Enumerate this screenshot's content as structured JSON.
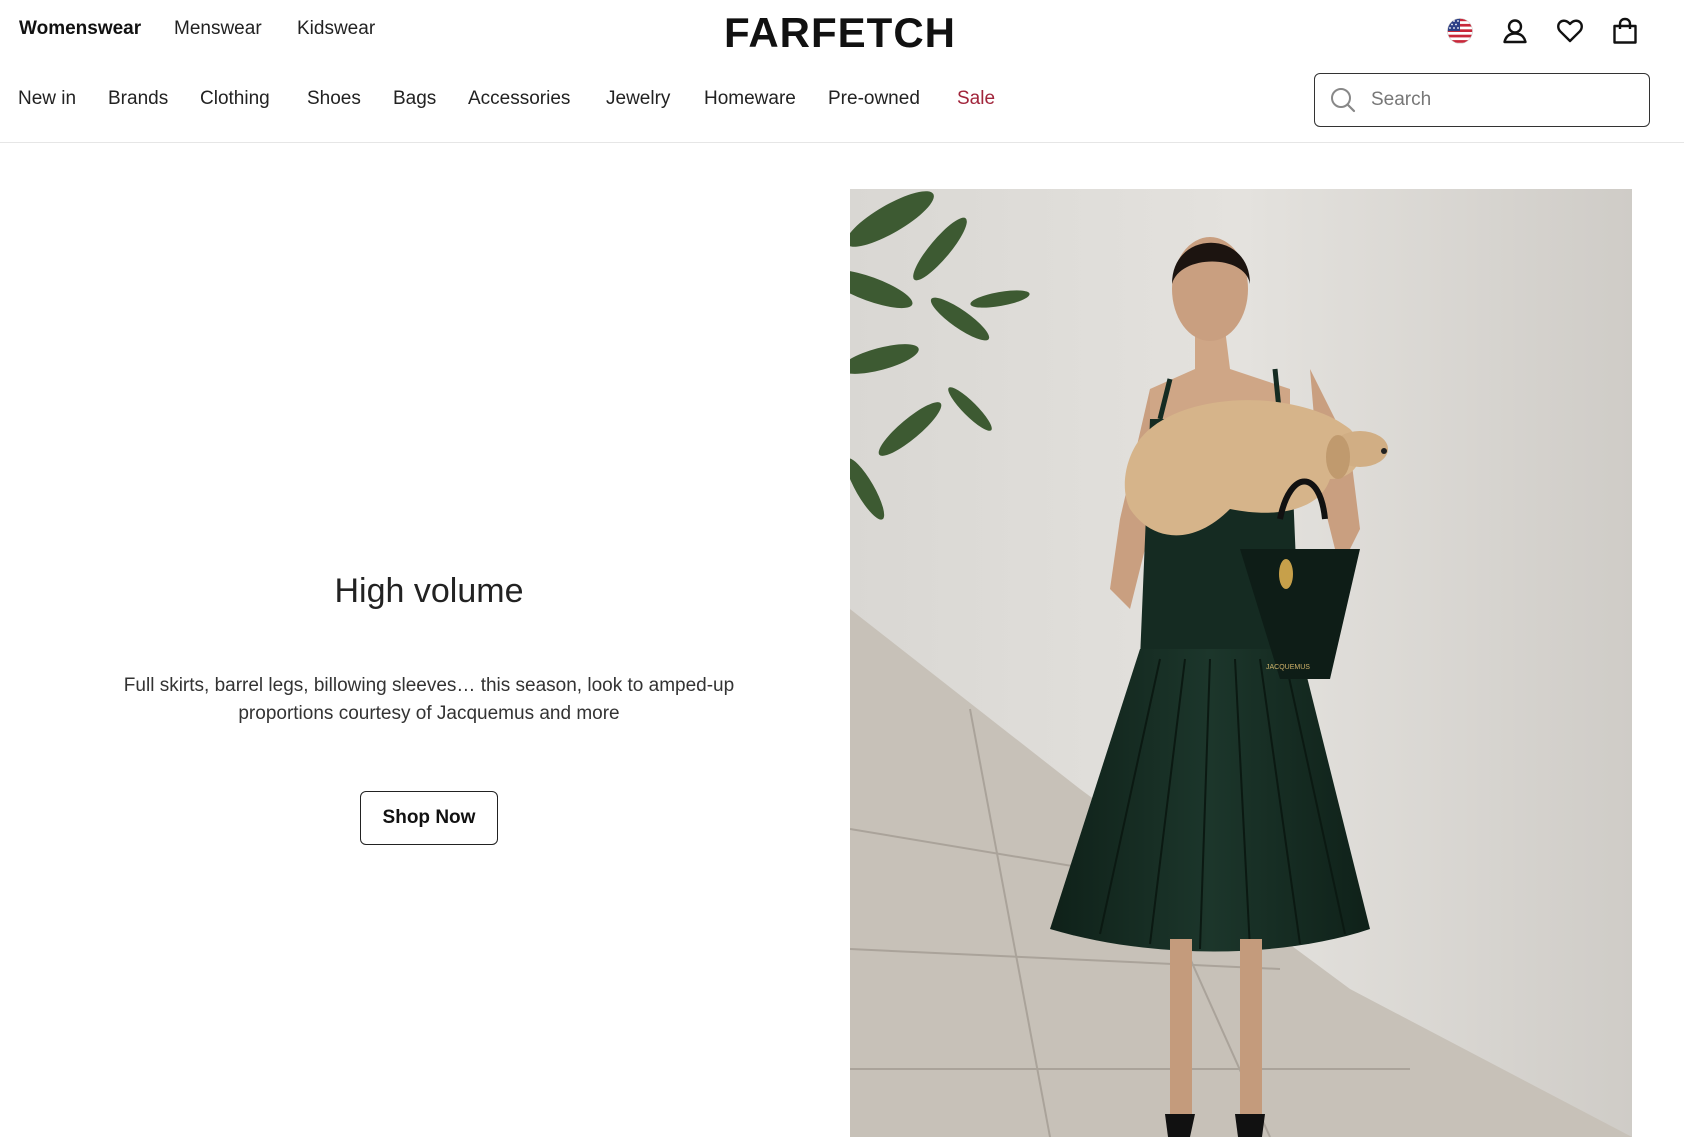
{
  "header": {
    "gender_tabs": [
      {
        "label": "Womenswear",
        "active": true
      },
      {
        "label": "Menswear",
        "active": false
      },
      {
        "label": "Kidswear",
        "active": false
      }
    ],
    "logo_text": "FARFETCH",
    "utility_icons": [
      "us-flag-icon",
      "account-icon",
      "wishlist-heart-icon",
      "shopping-bag-icon"
    ]
  },
  "nav": {
    "items": [
      {
        "label": "New in"
      },
      {
        "label": "Brands"
      },
      {
        "label": "Clothing"
      },
      {
        "label": "Shoes"
      },
      {
        "label": "Bags"
      },
      {
        "label": "Accessories"
      },
      {
        "label": "Jewelry"
      },
      {
        "label": "Homeware"
      },
      {
        "label": "Pre-owned"
      },
      {
        "label": "Sale"
      }
    ],
    "sale_color": "#a1253b",
    "search": {
      "placeholder": "Search",
      "value": ""
    }
  },
  "hero": {
    "title": "High volume",
    "description": "Full skirts, barrel legs, billowing sleeves… this season, look to amped-up proportions courtesy of Jacquemus and more",
    "button_label": "Shop Now",
    "image_bag_brand": "JACQUEMUS"
  },
  "colors": {
    "text": "#222222",
    "dress": "#152b22",
    "wall": "#dedcd8",
    "pavement": "#c6c1b9"
  }
}
